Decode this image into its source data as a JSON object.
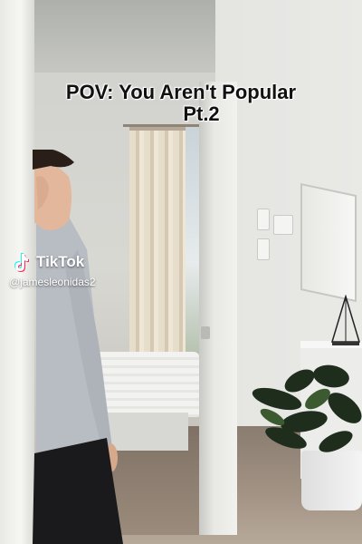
{
  "video": {
    "caption_line1": "POV: You Aren't Popular",
    "caption_line2": "Pt.2"
  },
  "watermark": {
    "brand": "TikTok",
    "username": "@jamesleonidas2",
    "logo_icon": "tiktok-logo-icon"
  },
  "colors": {
    "caption_text": "#111111",
    "watermark_text": "#ffffff"
  }
}
